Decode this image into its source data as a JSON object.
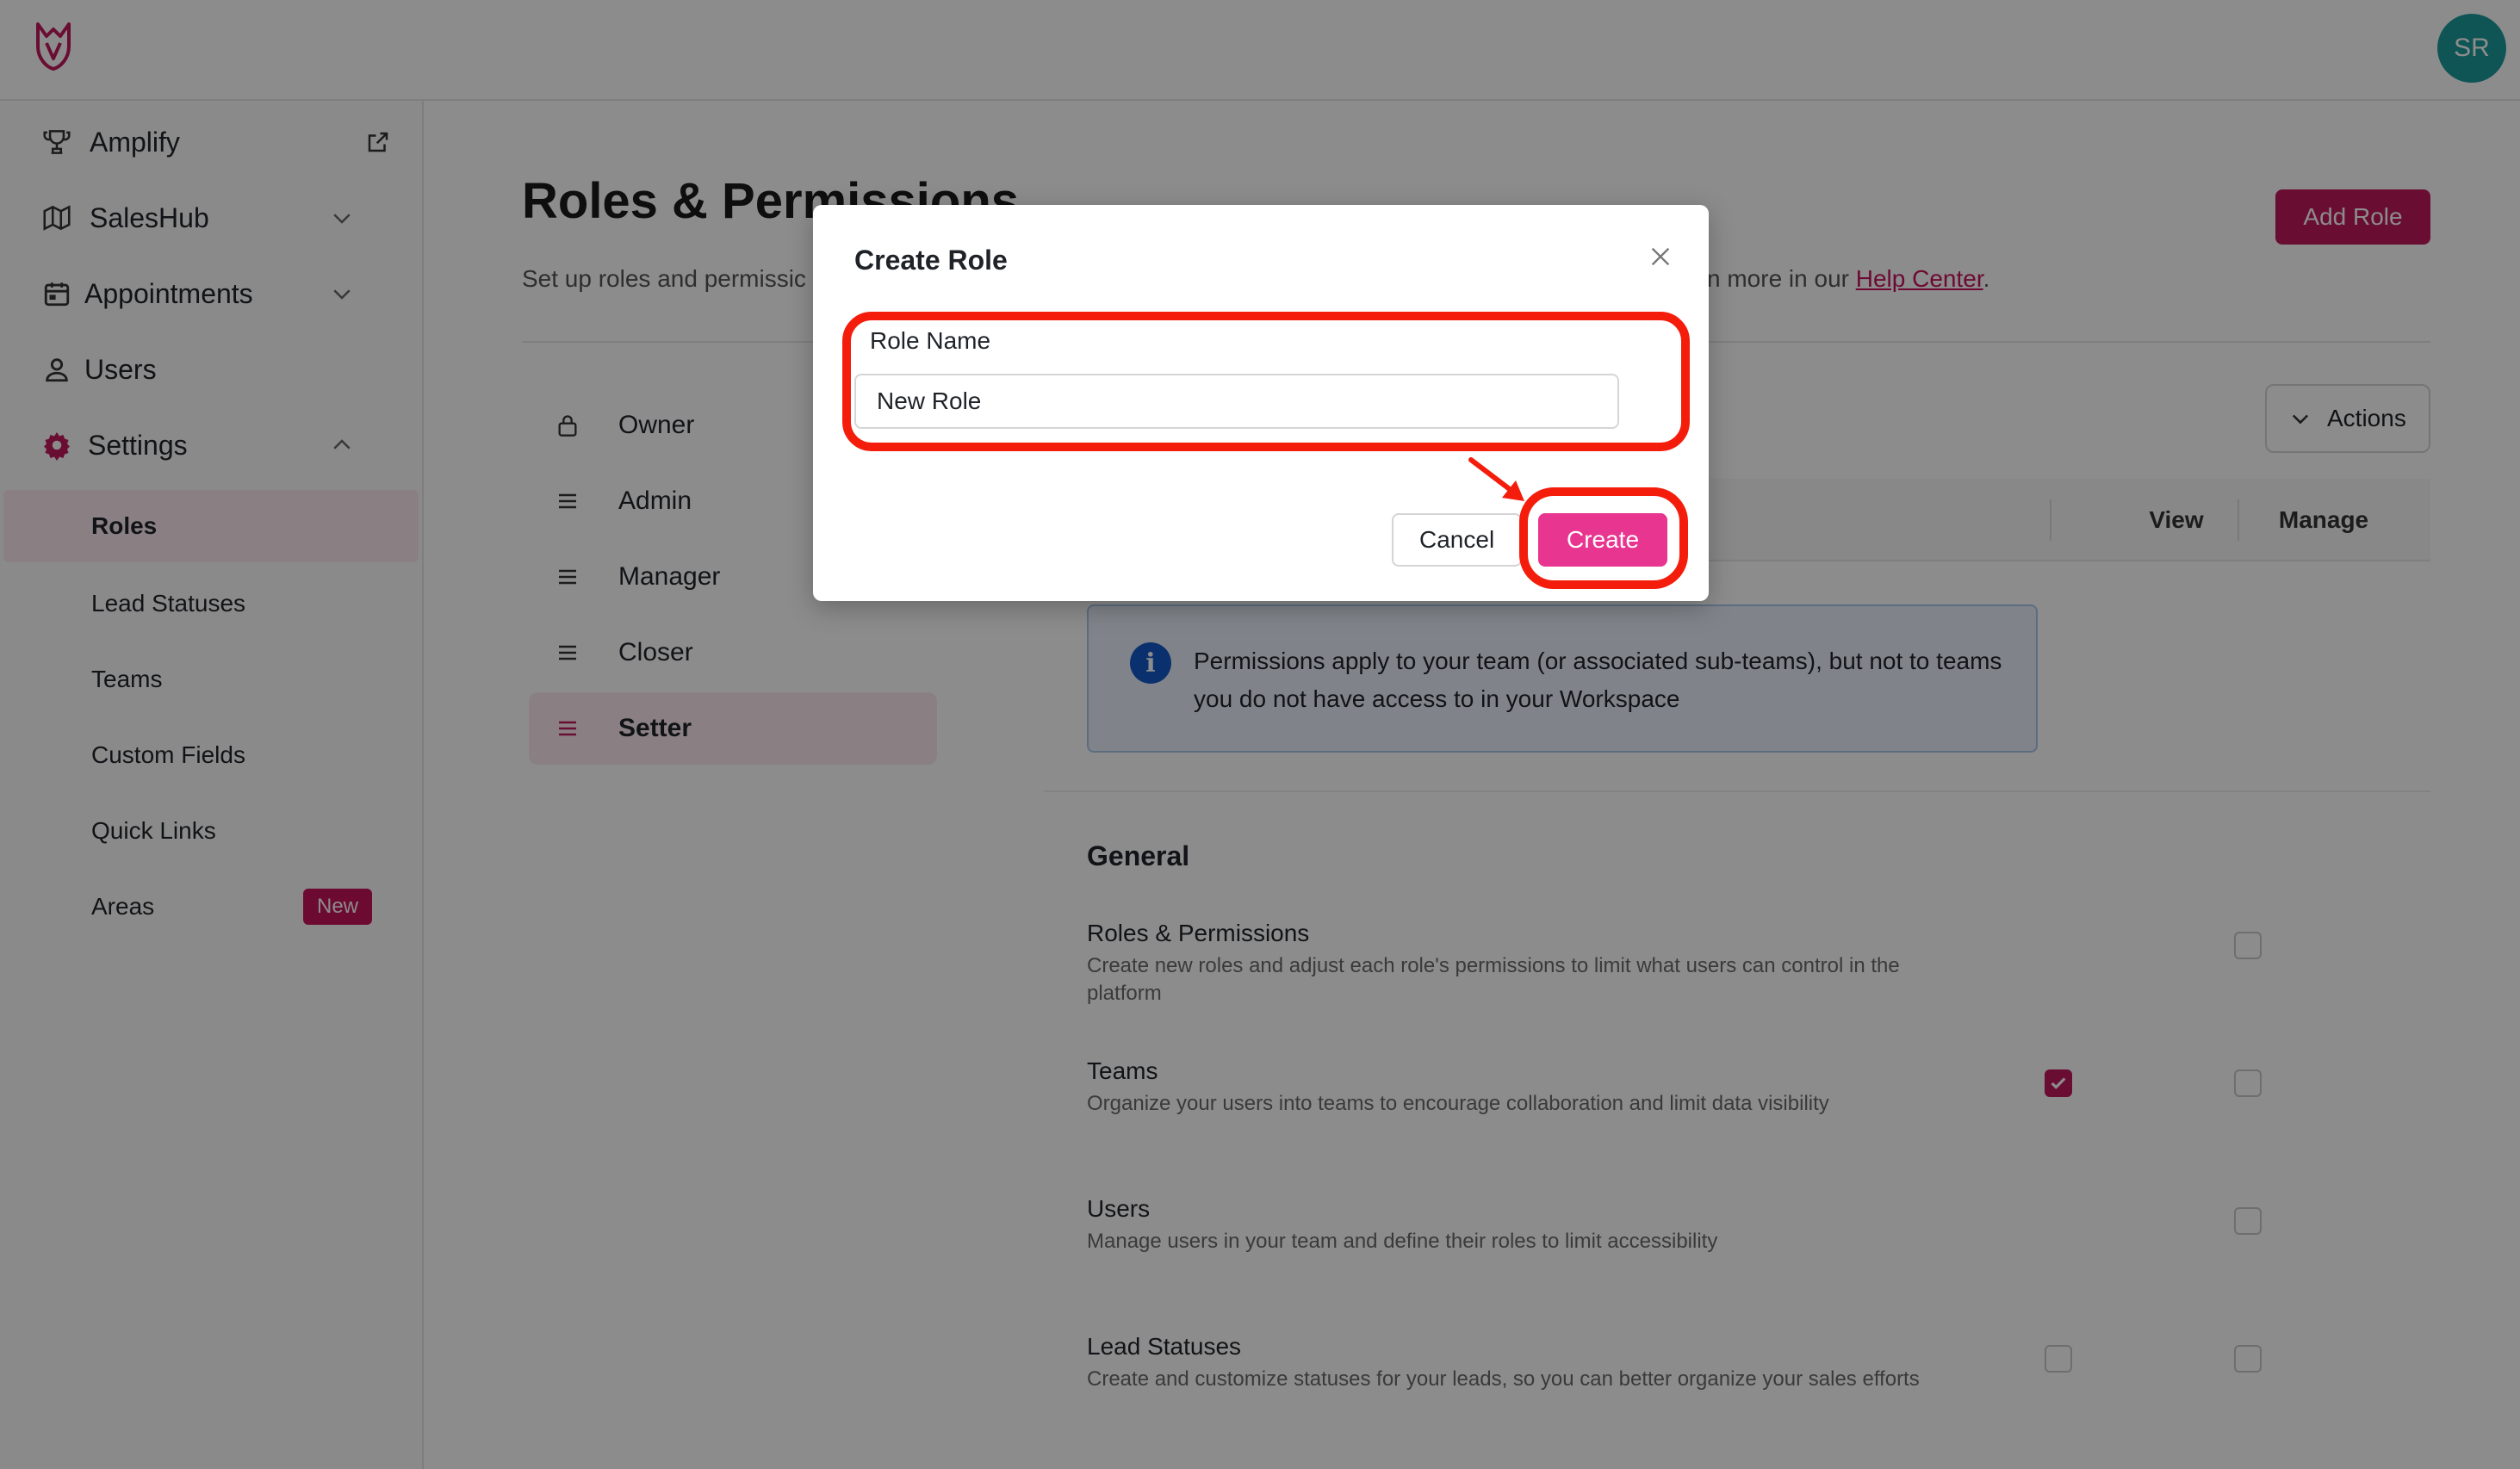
{
  "topbar": {
    "avatar_initials": "SR",
    "logo": "fox-logo-icon"
  },
  "sidebar": {
    "items": [
      {
        "label": "Amplify",
        "icon": "trophy-icon"
      },
      {
        "label": "SalesHub",
        "icon": "map-icon"
      },
      {
        "label": "Appointments",
        "icon": "calendar-icon"
      },
      {
        "label": "Users",
        "icon": "user-icon"
      },
      {
        "label": "Settings",
        "icon": "gear-icon"
      }
    ],
    "settings_sub": [
      {
        "label": "Roles"
      },
      {
        "label": "Lead Statuses"
      },
      {
        "label": "Teams"
      },
      {
        "label": "Custom Fields"
      },
      {
        "label": "Quick Links"
      },
      {
        "label": "Areas",
        "badge": "New"
      }
    ]
  },
  "main": {
    "title": "Roles & Permissions",
    "subtitle_left": "Set up roles and permissic",
    "subtitle_right_prefix": "n more in our ",
    "help_link": "Help Center",
    "subtitle_right_suffix": ".",
    "add_role_label": "Add Role",
    "actions_label": "Actions",
    "roles": [
      {
        "label": "Owner",
        "icon": "lock-icon"
      },
      {
        "label": "Admin",
        "icon": "drag-handle-icon"
      },
      {
        "label": "Manager",
        "icon": "drag-handle-icon"
      },
      {
        "label": "Closer",
        "icon": "drag-handle-icon"
      },
      {
        "label": "Setter",
        "icon": "drag-handle-icon"
      }
    ],
    "columns": {
      "view": "View",
      "manage": "Manage"
    },
    "info_text": "Permissions apply to your team (or associated sub-teams), but not to teams you do not have access to in your Workspace",
    "section_title": "General",
    "permissions": [
      {
        "title": "Roles & Permissions",
        "desc": "Create new roles and adjust each role's permissions to limit what users can control in the platform",
        "view": null,
        "manage": false
      },
      {
        "title": "Teams",
        "desc": "Organize your users into teams to encourage collaboration and limit data visibility",
        "view": true,
        "manage": false
      },
      {
        "title": "Users",
        "desc": "Manage users in your team and define their roles to limit accessibility",
        "view": null,
        "manage": false
      },
      {
        "title": "Lead Statuses",
        "desc": "Create and customize statuses for your leads, so you can better organize your sales efforts",
        "view": false,
        "manage": false
      }
    ]
  },
  "modal": {
    "title": "Create Role",
    "field_label": "Role Name",
    "field_value": "New Role",
    "cancel_label": "Cancel",
    "create_label": "Create"
  },
  "colors": {
    "accent": "#c2185b",
    "create_button": "#e8358f",
    "annotation": "#f41d0c",
    "avatar": "#1c9b9b"
  }
}
